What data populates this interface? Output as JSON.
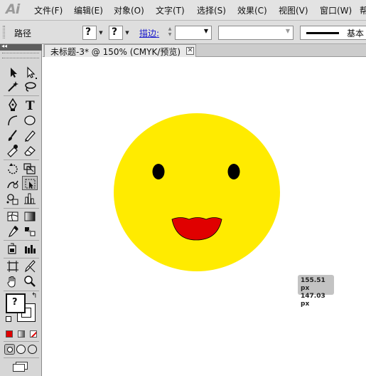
{
  "app": {
    "logo": "Ai"
  },
  "menu": [
    {
      "label": "文件(F)"
    },
    {
      "label": "编辑(E)"
    },
    {
      "label": "对象(O)"
    },
    {
      "label": "文字(T)"
    },
    {
      "label": "选择(S)"
    },
    {
      "label": "效果(C)"
    },
    {
      "label": "视图(V)"
    },
    {
      "label": "窗口(W)"
    },
    {
      "label": "帮"
    }
  ],
  "control_bar": {
    "selection_label": "路径",
    "fill_value": "?",
    "stroke_value": "?",
    "stroke_label": "描边:",
    "stroke_weight": "",
    "brush_style": "基本"
  },
  "document": {
    "tab_title": "未标题-3* @ 150% (CMYK/预览)",
    "close_glyph": "✕"
  },
  "tools_panel": {
    "collapse_glyph": "◂◂",
    "fill_stroke_unknown": "?"
  },
  "measurement": {
    "width": "155.51 px",
    "height": "147.03 px"
  },
  "colors": {
    "face": "#ffeb00",
    "mouth": "#e00000",
    "eyes": "#000000"
  }
}
